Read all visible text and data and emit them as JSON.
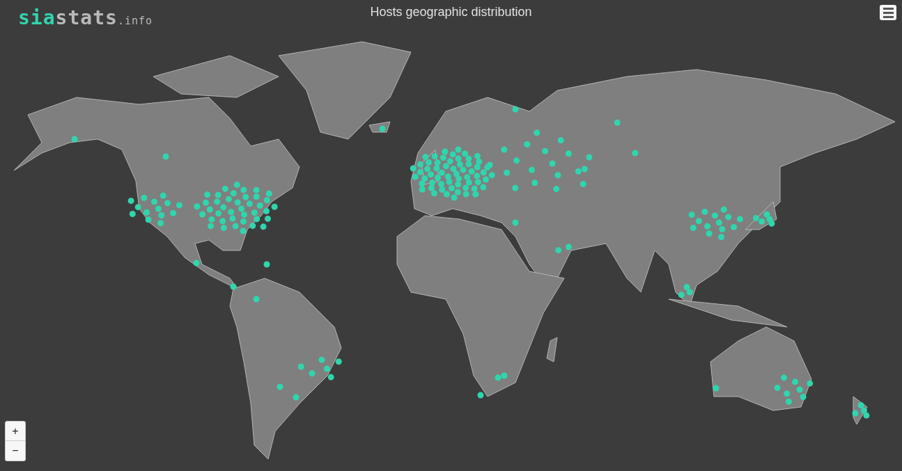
{
  "logo": {
    "parts": [
      {
        "text": "sia",
        "color": "#2fd6ad"
      },
      {
        "text": "stats",
        "color": "#b9b9b9"
      },
      {
        "text": ".info",
        "color": "#b9b9b9"
      }
    ]
  },
  "title": "Hosts geographic distribution",
  "zoom_controls": [
    "+",
    "−"
  ]
}
